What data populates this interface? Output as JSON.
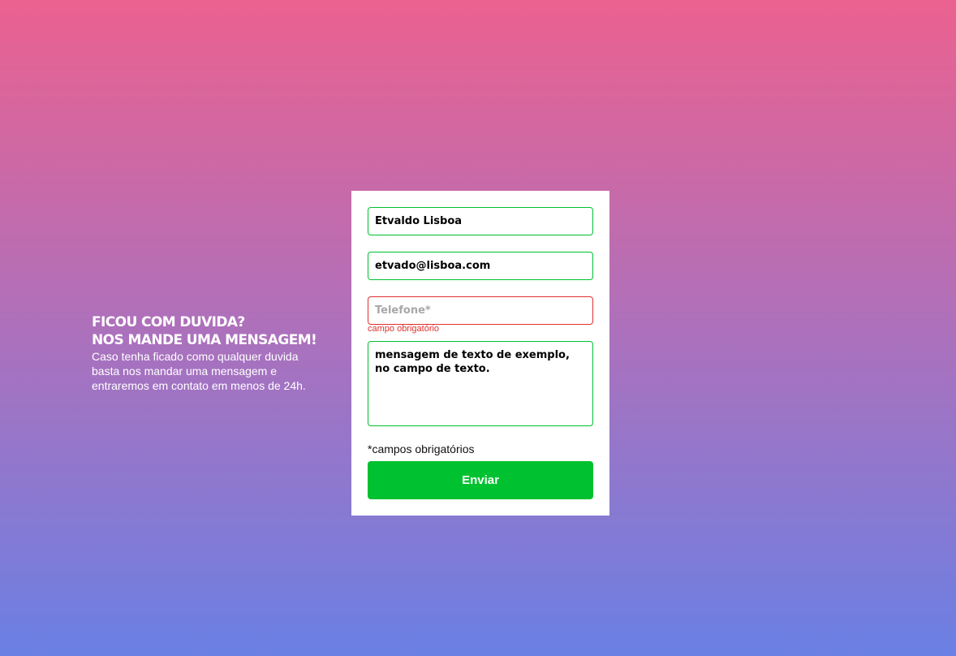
{
  "intro": {
    "heading_line1": "FICOU COM DUVIDA?",
    "heading_line2": "NOS MANDE UMA MENSAGEM!",
    "text": "Caso tenha ficado como qualquer duvida basta nos mandar uma mensagem e entraremos em contato em menos de 24h."
  },
  "form": {
    "name_value": "Etvaldo Lisboa",
    "email_value": "etvado@lisboa.com",
    "phone_value": "",
    "phone_placeholder": "Telefone*",
    "phone_error": "campo obrigatório",
    "message_value": "mensagem de texto de exemplo, no campo de texto.",
    "required_note": "*campos obrigatórios",
    "submit_label": "Enviar"
  },
  "colors": {
    "gradient_top": "#eb618f",
    "gradient_bottom": "#6a80e4",
    "valid_border": "#00c12f",
    "error": "#e0312f",
    "button": "#00c12f"
  }
}
